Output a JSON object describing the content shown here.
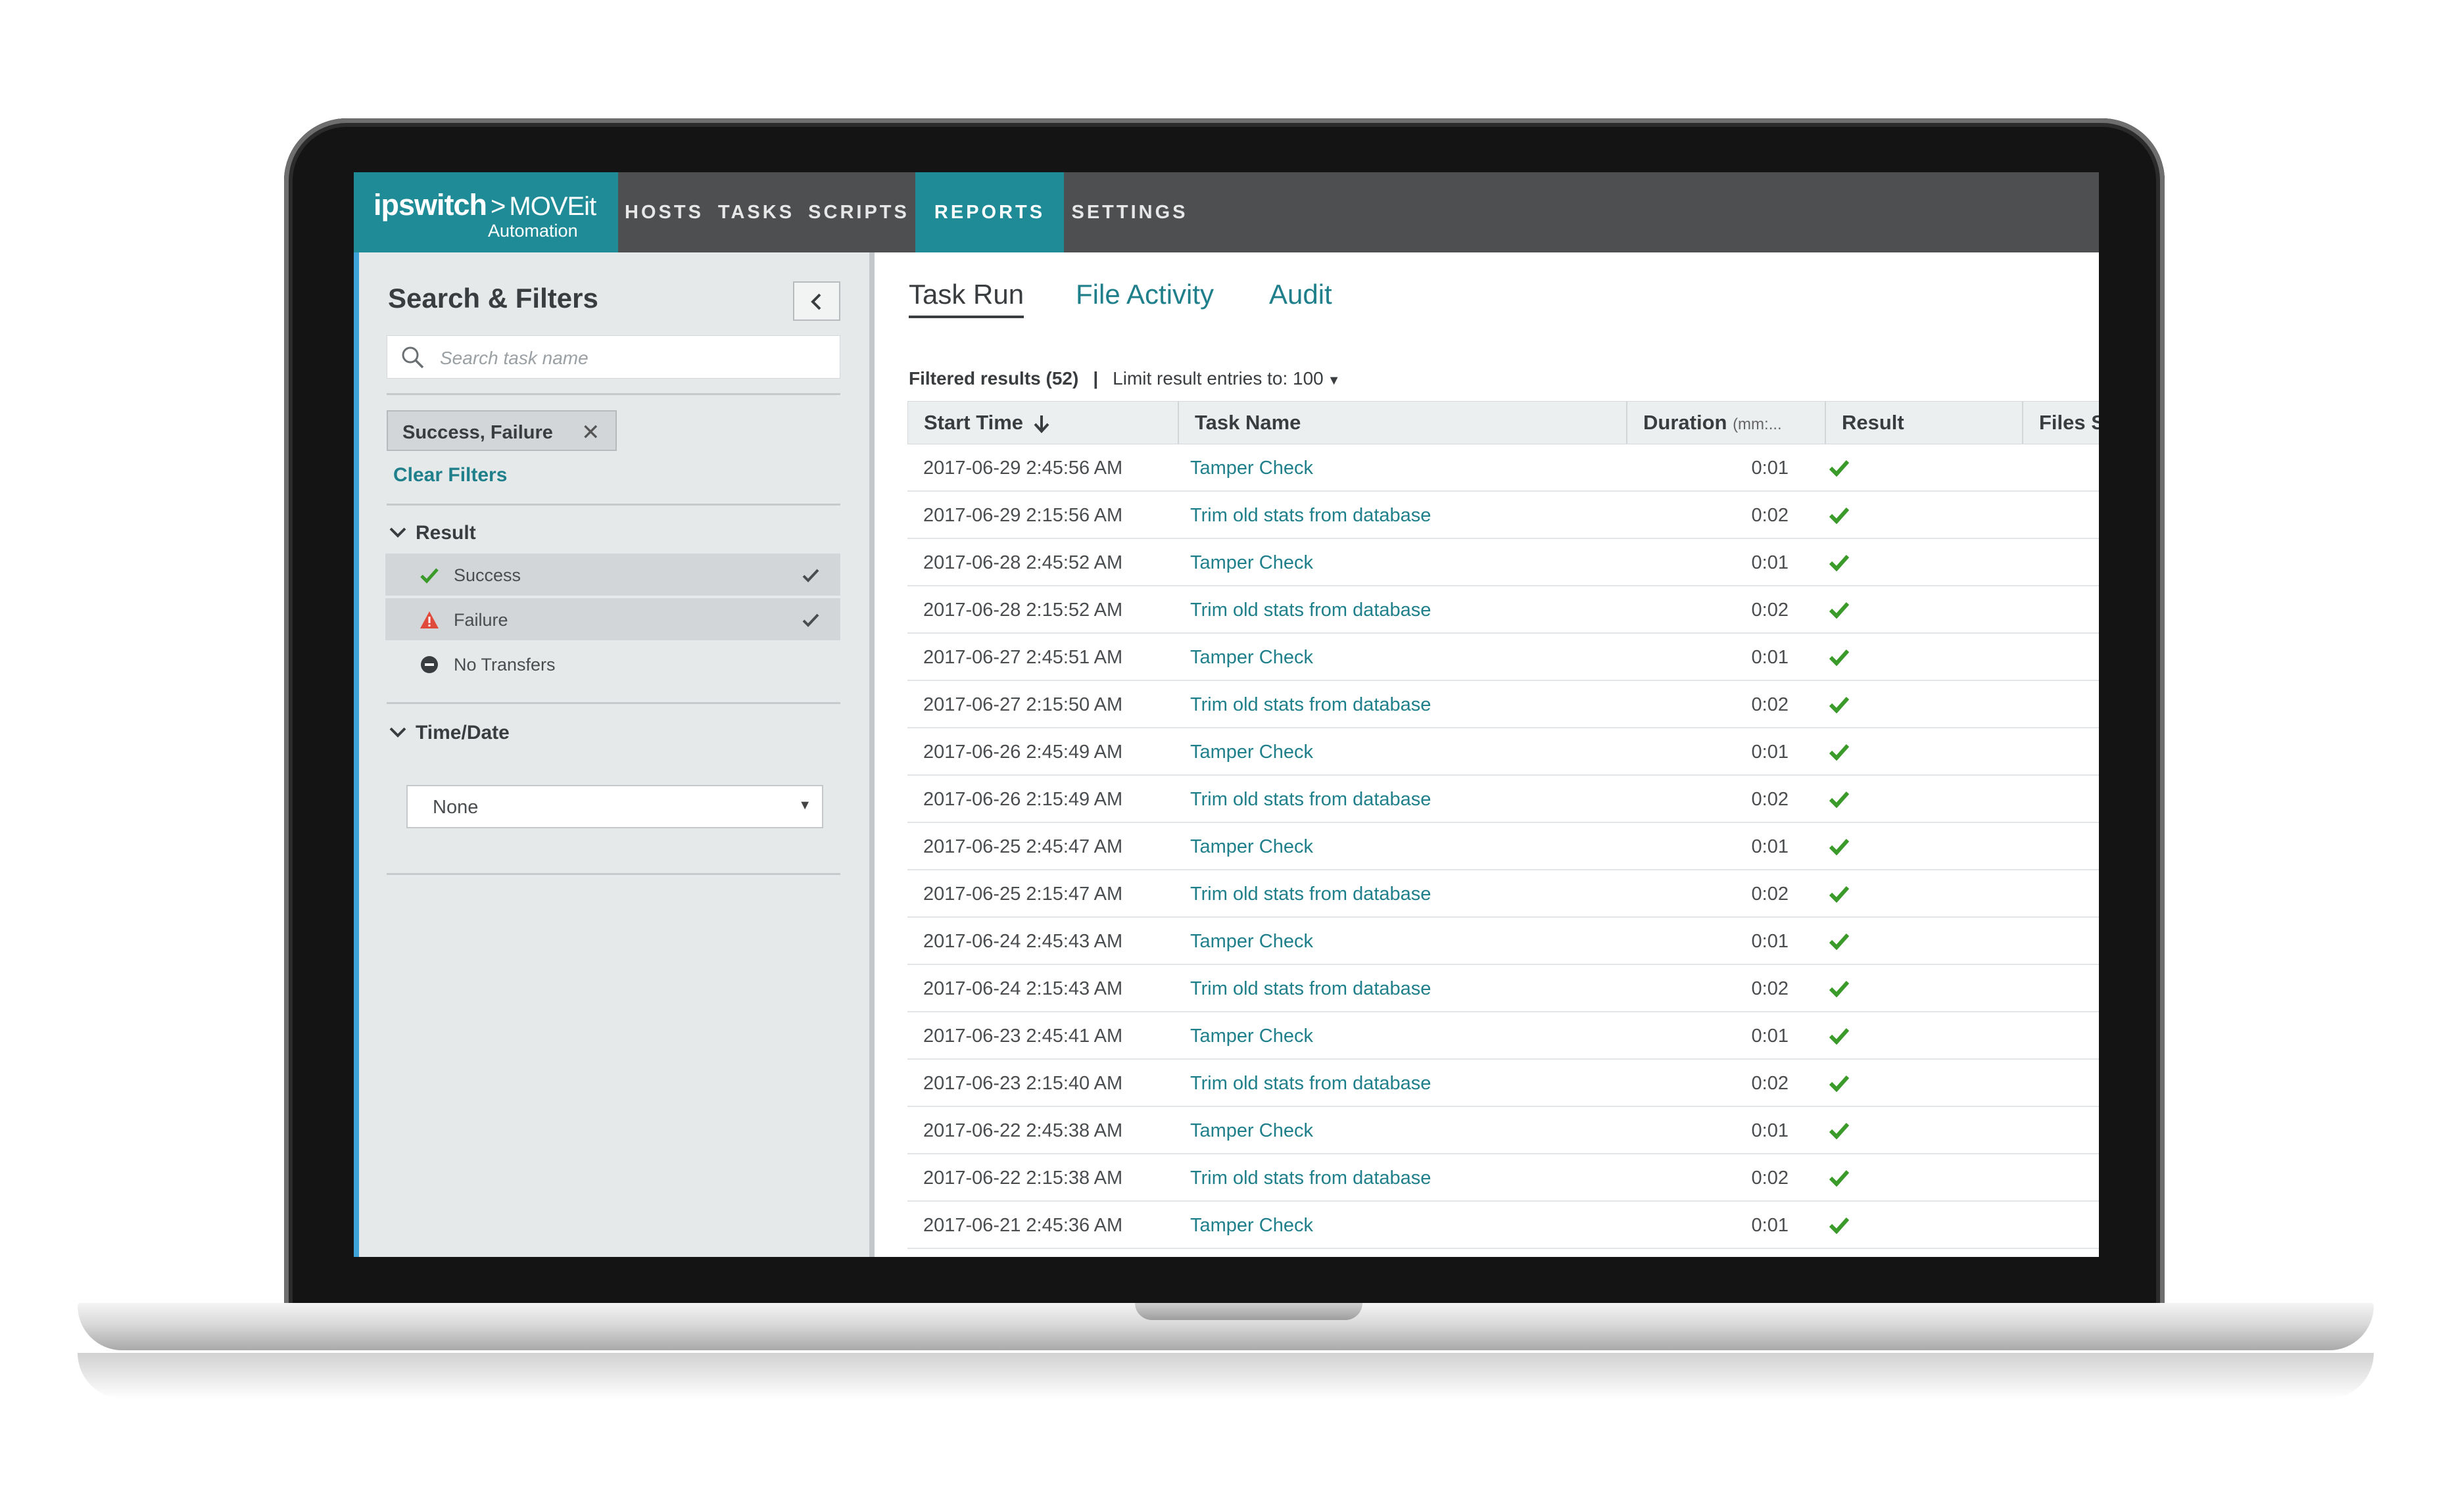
{
  "brand": {
    "name": "ipswitch",
    "separator": ">",
    "product": "MOVEit",
    "subtitle": "Automation",
    "accent": "#1f8b97",
    "topbar_bg": "#4d4f51"
  },
  "nav": {
    "hosts": "HOSTS",
    "tasks": "TASKS",
    "scripts": "SCRIPTS",
    "reports": "REPORTS",
    "settings": "SETTINGS",
    "active": "REPORTS"
  },
  "sidebar": {
    "title": "Search & Filters",
    "collapse_icon": "chevron-left-icon",
    "search_placeholder": "Search task name",
    "active_filter": "Success, Failure",
    "clear_filters": "Clear Filters",
    "result": {
      "heading": "Result",
      "options": [
        {
          "label": "Success",
          "icon": "check-icon",
          "selected": true
        },
        {
          "label": "Failure",
          "icon": "warning-icon",
          "selected": true
        },
        {
          "label": "No Transfers",
          "icon": "minus-circle-icon",
          "selected": false
        }
      ]
    },
    "time_date": {
      "heading": "Time/Date",
      "selected": "None"
    }
  },
  "tabs": {
    "task_run": "Task Run",
    "file_activity": "File Activity",
    "audit": "Audit",
    "active": "Task Run"
  },
  "summary": {
    "filtered": "Filtered results (52)",
    "separator": "|",
    "limit": "Limit result entries to: 100"
  },
  "table": {
    "headers": {
      "start_time": "Start Time",
      "task_name": "Task Name",
      "duration": "Duration",
      "duration_unit": "(mm:...",
      "result": "Result",
      "files": "Files S"
    },
    "sort_icon": "arrow-down-icon",
    "success_color": "#3a9a2a",
    "rows": [
      {
        "start_time": "2017-06-29 2:45:56 AM",
        "task_name": "Tamper Check",
        "duration": "0:01",
        "result": "success"
      },
      {
        "start_time": "2017-06-29 2:15:56 AM",
        "task_name": "Trim old stats from database",
        "duration": "0:02",
        "result": "success"
      },
      {
        "start_time": "2017-06-28 2:45:52 AM",
        "task_name": "Tamper Check",
        "duration": "0:01",
        "result": "success"
      },
      {
        "start_time": "2017-06-28 2:15:52 AM",
        "task_name": "Trim old stats from database",
        "duration": "0:02",
        "result": "success"
      },
      {
        "start_time": "2017-06-27 2:45:51 AM",
        "task_name": "Tamper Check",
        "duration": "0:01",
        "result": "success"
      },
      {
        "start_time": "2017-06-27 2:15:50 AM",
        "task_name": "Trim old stats from database",
        "duration": "0:02",
        "result": "success"
      },
      {
        "start_time": "2017-06-26 2:45:49 AM",
        "task_name": "Tamper Check",
        "duration": "0:01",
        "result": "success"
      },
      {
        "start_time": "2017-06-26 2:15:49 AM",
        "task_name": "Trim old stats from database",
        "duration": "0:02",
        "result": "success"
      },
      {
        "start_time": "2017-06-25 2:45:47 AM",
        "task_name": "Tamper Check",
        "duration": "0:01",
        "result": "success"
      },
      {
        "start_time": "2017-06-25 2:15:47 AM",
        "task_name": "Trim old stats from database",
        "duration": "0:02",
        "result": "success"
      },
      {
        "start_time": "2017-06-24 2:45:43 AM",
        "task_name": "Tamper Check",
        "duration": "0:01",
        "result": "success"
      },
      {
        "start_time": "2017-06-24 2:15:43 AM",
        "task_name": "Trim old stats from database",
        "duration": "0:02",
        "result": "success"
      },
      {
        "start_time": "2017-06-23 2:45:41 AM",
        "task_name": "Tamper Check",
        "duration": "0:01",
        "result": "success"
      },
      {
        "start_time": "2017-06-23 2:15:40 AM",
        "task_name": "Trim old stats from database",
        "duration": "0:02",
        "result": "success"
      },
      {
        "start_time": "2017-06-22 2:45:38 AM",
        "task_name": "Tamper Check",
        "duration": "0:01",
        "result": "success"
      },
      {
        "start_time": "2017-06-22 2:15:38 AM",
        "task_name": "Trim old stats from database",
        "duration": "0:02",
        "result": "success"
      },
      {
        "start_time": "2017-06-21 2:45:36 AM",
        "task_name": "Tamper Check",
        "duration": "0:01",
        "result": "success"
      }
    ]
  }
}
